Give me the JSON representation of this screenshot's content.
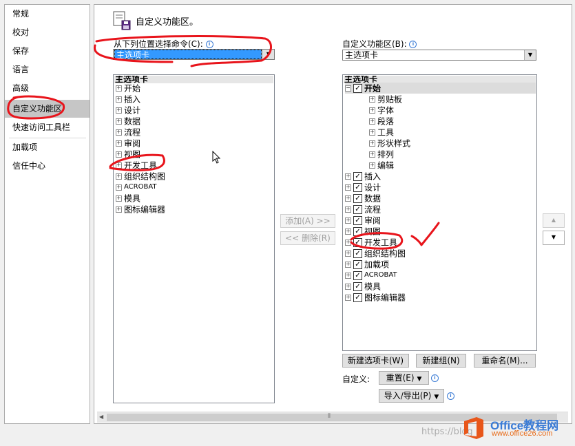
{
  "nav": {
    "items": [
      {
        "label": "常规"
      },
      {
        "label": "校对"
      },
      {
        "label": "保存"
      },
      {
        "label": "语言"
      },
      {
        "label": "高级"
      },
      {
        "label": "自定义功能区",
        "selected": true
      },
      {
        "label": "快速访问工具栏"
      },
      {
        "label": "加载项"
      },
      {
        "label": "信任中心"
      }
    ]
  },
  "header": {
    "title": "自定义功能区。"
  },
  "left_panel": {
    "label": "从下列位置选择命令(C):",
    "combo_value": "主选项卡",
    "list_header": "主选项卡",
    "items": [
      "开始",
      "插入",
      "设计",
      "数据",
      "流程",
      "审阅",
      "视图",
      "开发工具",
      "组织结构图",
      "ACROBAT",
      "模具",
      "图标编辑器"
    ]
  },
  "right_panel": {
    "label": "自定义功能区(B):",
    "combo_value": "主选项卡",
    "list_header": "主选项卡",
    "root": "开始",
    "root_groups": [
      "剪贴板",
      "字体",
      "段落",
      "工具",
      "形状样式",
      "排列",
      "编辑"
    ],
    "items": [
      "插入",
      "设计",
      "数据",
      "流程",
      "审阅",
      "视图",
      "开发工具",
      "组织结构图",
      "加载项",
      "ACROBAT",
      "模具",
      "图标编辑器"
    ]
  },
  "buttons": {
    "add": "添加(A) >>",
    "remove": "<< 删除(R)",
    "new_tab": "新建选项卡(W)",
    "new_group": "新建组(N)",
    "rename": "重命名(M)...",
    "custom_label": "自定义:",
    "reset": "重置(E)",
    "import_export": "导入/导出(P)",
    "move_up": "▲",
    "move_down": "▼"
  },
  "watermark": {
    "brand": "Office教程网",
    "site": "www.office26.com",
    "url": "https://blog"
  },
  "colors": {
    "selection": "#3399ff",
    "annotation": "#e8141b",
    "nav_selected": "#c6c6c6"
  }
}
